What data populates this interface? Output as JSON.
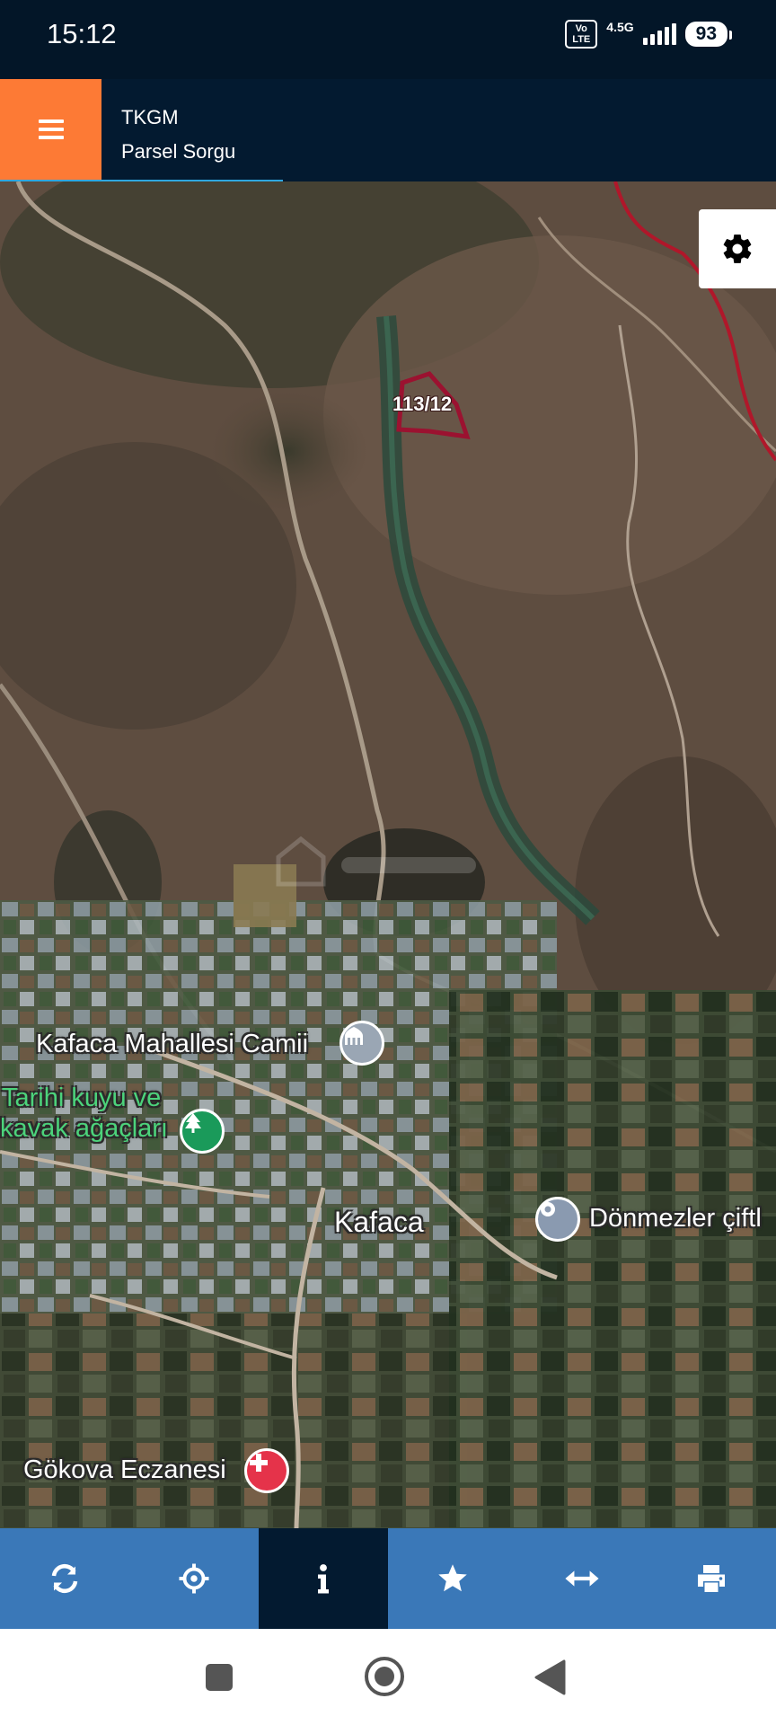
{
  "status_bar": {
    "time": "15:12",
    "volte_top": "Vo",
    "volte_bottom": "LTE",
    "network": "4.5G",
    "battery": "93"
  },
  "header": {
    "title": "TKGM",
    "subtitle": "Parsel Sorgu",
    "accent_color": "#fd7a35",
    "background_color": "#031a30"
  },
  "map": {
    "type": "satellite",
    "parcel_label": "113/12",
    "places": [
      {
        "label": "Kafaca Mahallesi Camii",
        "icon": "mosque-icon"
      },
      {
        "label": "Tarihi kuyu ve",
        "icon": "tree-icon"
      },
      {
        "label": "kavak ağaçları"
      },
      {
        "label": "Kafaca"
      },
      {
        "label": "Dönmezler çiftl",
        "icon": "place-pin-icon"
      },
      {
        "label": "Gökova Eczanesi",
        "icon": "pharmacy-icon"
      }
    ]
  },
  "toolbar": {
    "items": [
      {
        "icon": "refresh-icon",
        "active": false
      },
      {
        "icon": "crosshair-icon",
        "active": false
      },
      {
        "icon": "info-icon",
        "active": true
      },
      {
        "icon": "star-icon",
        "active": false
      },
      {
        "icon": "measure-arrows-icon",
        "active": false
      },
      {
        "icon": "print-icon",
        "active": false
      }
    ]
  },
  "nav_bar": {
    "items": [
      "recents-square-icon",
      "home-circle-icon",
      "back-triangle-icon"
    ]
  }
}
